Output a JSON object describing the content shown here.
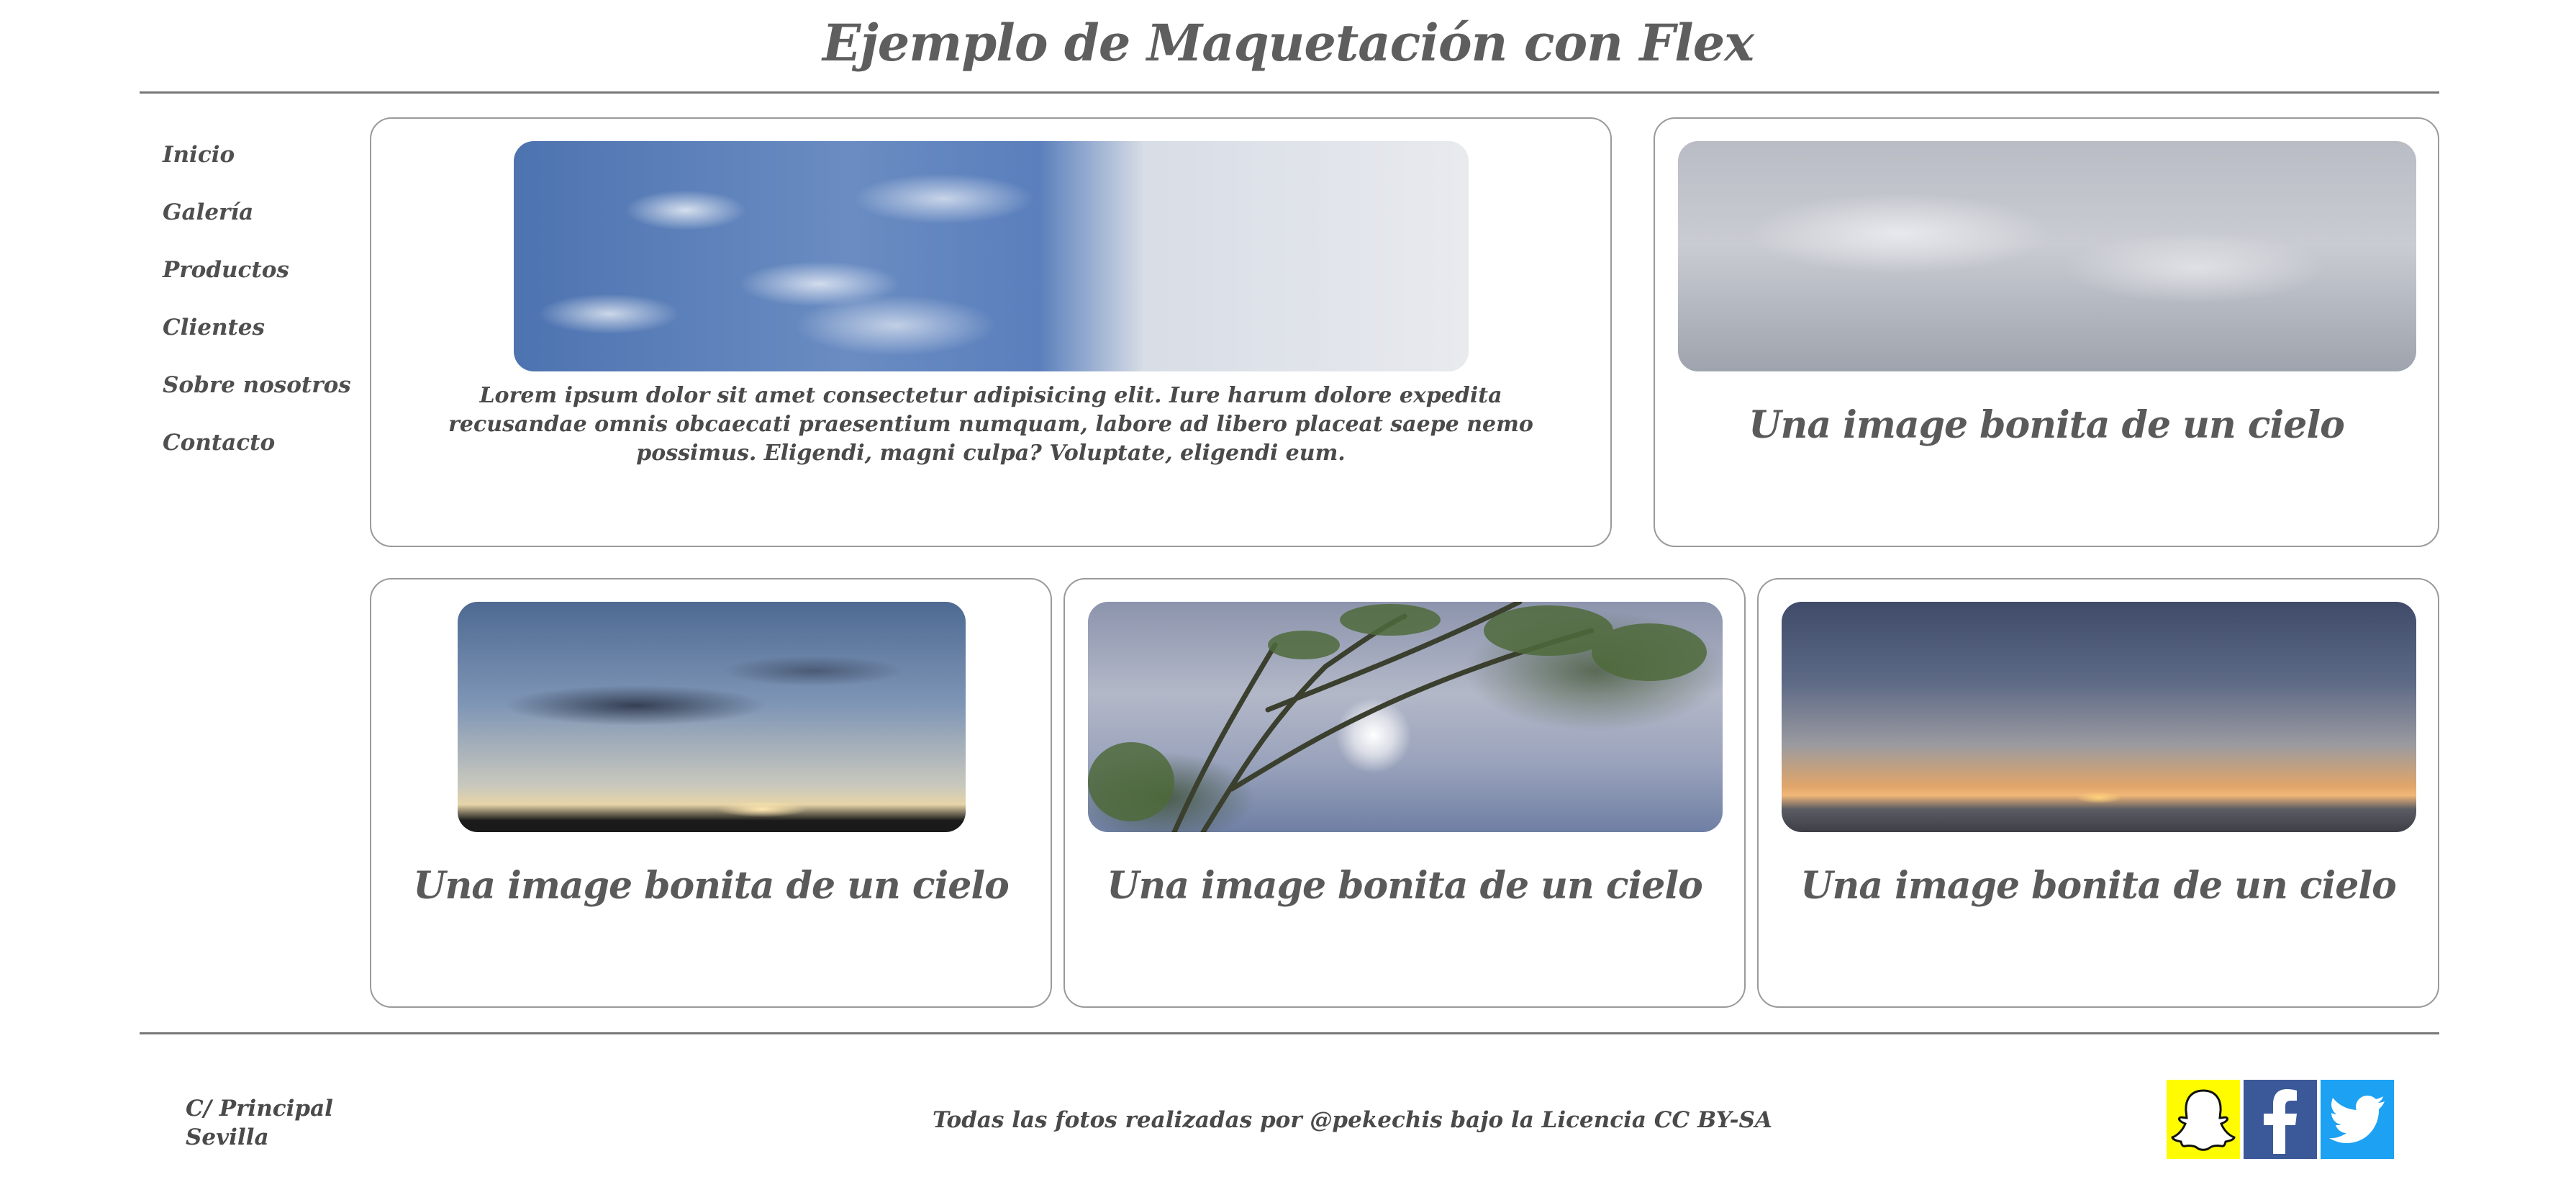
{
  "header": {
    "title": "Ejemplo de Maquetación con Flex"
  },
  "nav": {
    "items": [
      "Inicio",
      "Galería",
      "Productos",
      "Clientes",
      "Sobre nosotros",
      "Contacto"
    ]
  },
  "cards": [
    {
      "text": "Lorem ipsum dolor sit amet consectetur adipisicing elit. Iure harum dolore expedita recusandae omnis obcaecati praesentium numquam, labore ad libero placeat saepe nemo possimus. Eligendi, magni culpa? Voluptate, eligendi eum."
    },
    {
      "caption": "Una image bonita de un cielo"
    },
    {
      "caption": "Una image bonita de un cielo"
    },
    {
      "caption": "Una image bonita de un cielo"
    },
    {
      "caption": "Una image bonita de un cielo"
    }
  ],
  "footer": {
    "address_line1": "C/ Principal",
    "address_line2": "Sevilla",
    "credit": "Todas las fotos realizadas por @pekechis bajo la Licencia CC BY-SA",
    "social": [
      {
        "icon": "snapchat-icon",
        "color": "#fffc00"
      },
      {
        "icon": "facebook-icon",
        "color": "#3b5998"
      },
      {
        "icon": "twitter-icon",
        "color": "#1da1f2"
      }
    ]
  }
}
